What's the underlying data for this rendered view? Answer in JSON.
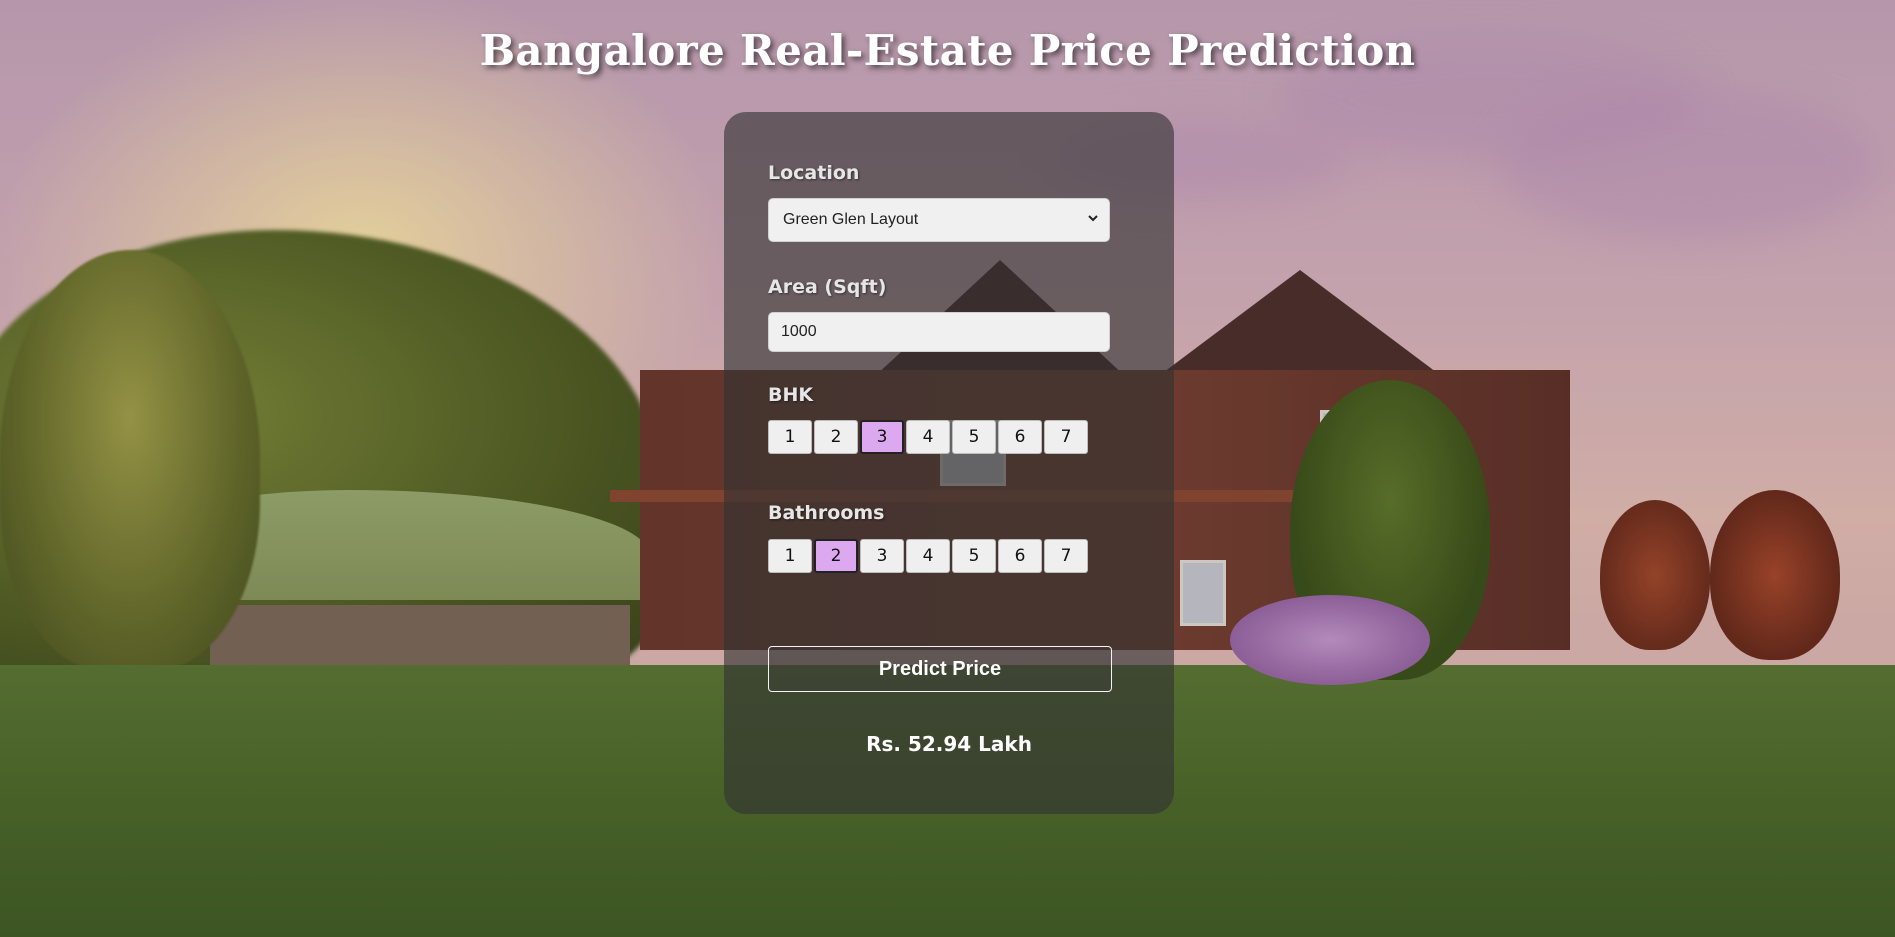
{
  "page": {
    "title": "Bangalore Real-Estate Price Prediction"
  },
  "form": {
    "location": {
      "label": "Location",
      "selected": "Green Glen Layout"
    },
    "area": {
      "label": "Area (Sqft)",
      "value": "1000"
    },
    "bhk": {
      "label": "BHK",
      "options": [
        "1",
        "2",
        "3",
        "4",
        "5",
        "6",
        "7"
      ],
      "selected": "3"
    },
    "bathrooms": {
      "label": "Bathrooms",
      "options": [
        "1",
        "2",
        "3",
        "4",
        "5",
        "6",
        "7"
      ],
      "selected": "2"
    },
    "submit_label": "Predict Price",
    "result": "Rs. 52.94 Lakh"
  },
  "colors": {
    "selected_option": "#dca8f0",
    "card_bg": "rgba(50,50,50,0.62)"
  },
  "icons": {
    "select_arrow": "chevron-down-icon"
  }
}
